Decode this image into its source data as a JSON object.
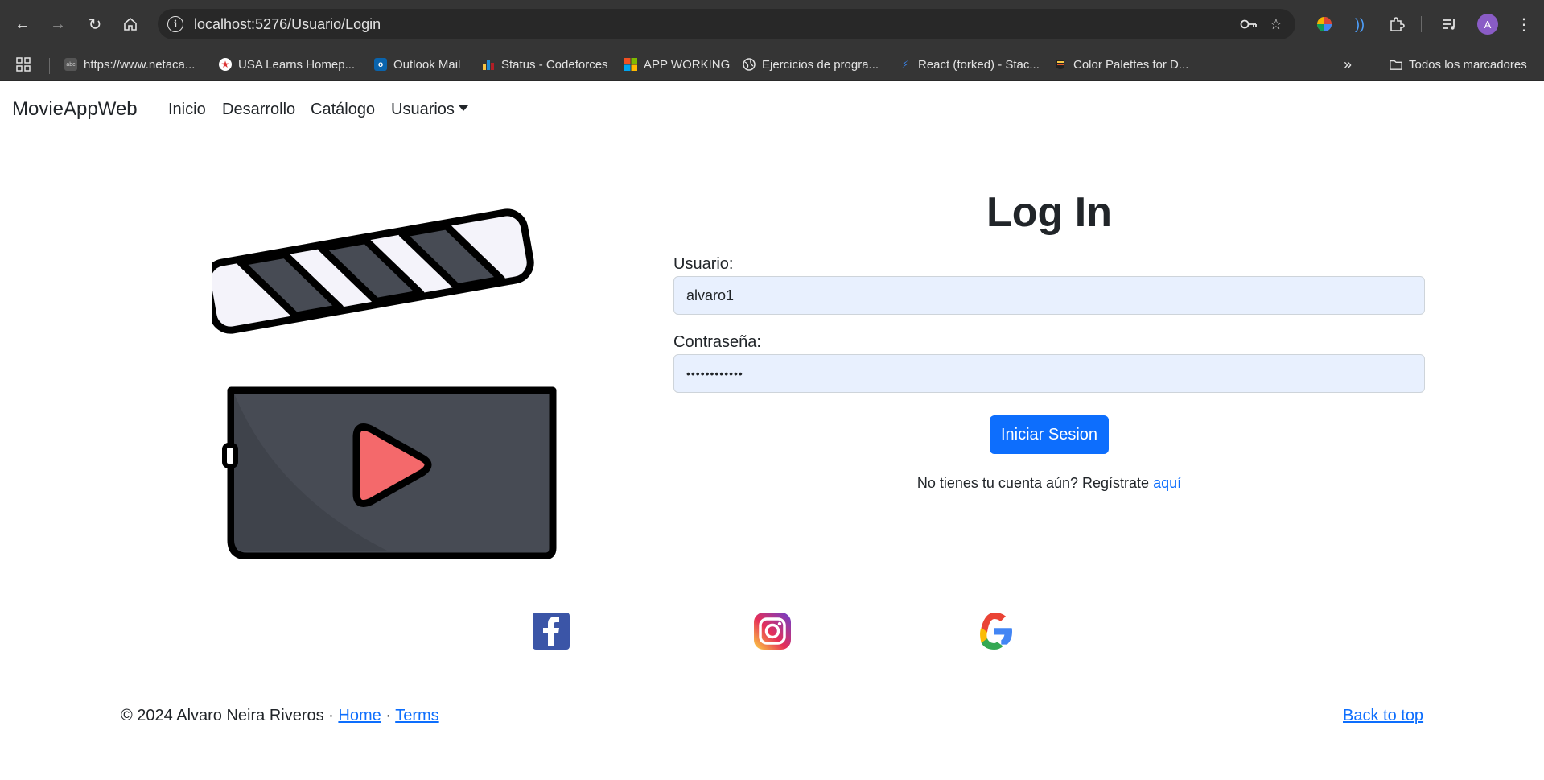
{
  "browser": {
    "url": "localhost:5276/Usuario/Login",
    "bookmarks": [
      {
        "label": "https://www.netaca...",
        "icon": "page-icon"
      },
      {
        "label": "USA Learns Homep...",
        "icon": "star-badge-icon"
      },
      {
        "label": "Outlook Mail",
        "icon": "outlook-icon"
      },
      {
        "label": "Status - Codeforces",
        "icon": "codeforces-icon"
      },
      {
        "label": "APP WORKING",
        "icon": "microsoft-icon"
      },
      {
        "label": "Ejercicios de progra...",
        "icon": "globe-icon"
      },
      {
        "label": "React (forked) - Stac...",
        "icon": "lightning-icon"
      },
      {
        "label": "Color Palettes for D...",
        "icon": "palette-icon"
      }
    ],
    "all_bookmarks_label": "Todos los marcadores",
    "avatar_letter": "A"
  },
  "navbar": {
    "brand": "MovieAppWeb",
    "links": [
      "Inicio",
      "Desarrollo",
      "Catálogo",
      "Usuarios"
    ]
  },
  "login": {
    "title": "Log In",
    "user_label": "Usuario:",
    "user_value": "alvaro1",
    "password_label": "Contraseña:",
    "password_value": "••••••••••••",
    "submit_label": "Iniciar Sesion",
    "register_text": "No tienes tu cuenta aún? Regístrate",
    "register_link": "aquí"
  },
  "social": [
    "facebook-icon",
    "instagram-icon",
    "google-icon"
  ],
  "footer": {
    "copyright": "© 2024 Alvaro Neira Riveros ·",
    "home": "Home",
    "separator": "·",
    "terms": "Terms",
    "back_to_top": "Back to top"
  },
  "colors": {
    "primary": "#0d6efd",
    "input_autofill": "#e8f0fe",
    "chrome_bg": "#353535",
    "clapper_dark": "#474b54",
    "clapper_light": "#f4f3fa",
    "play_red": "#f4696b"
  }
}
